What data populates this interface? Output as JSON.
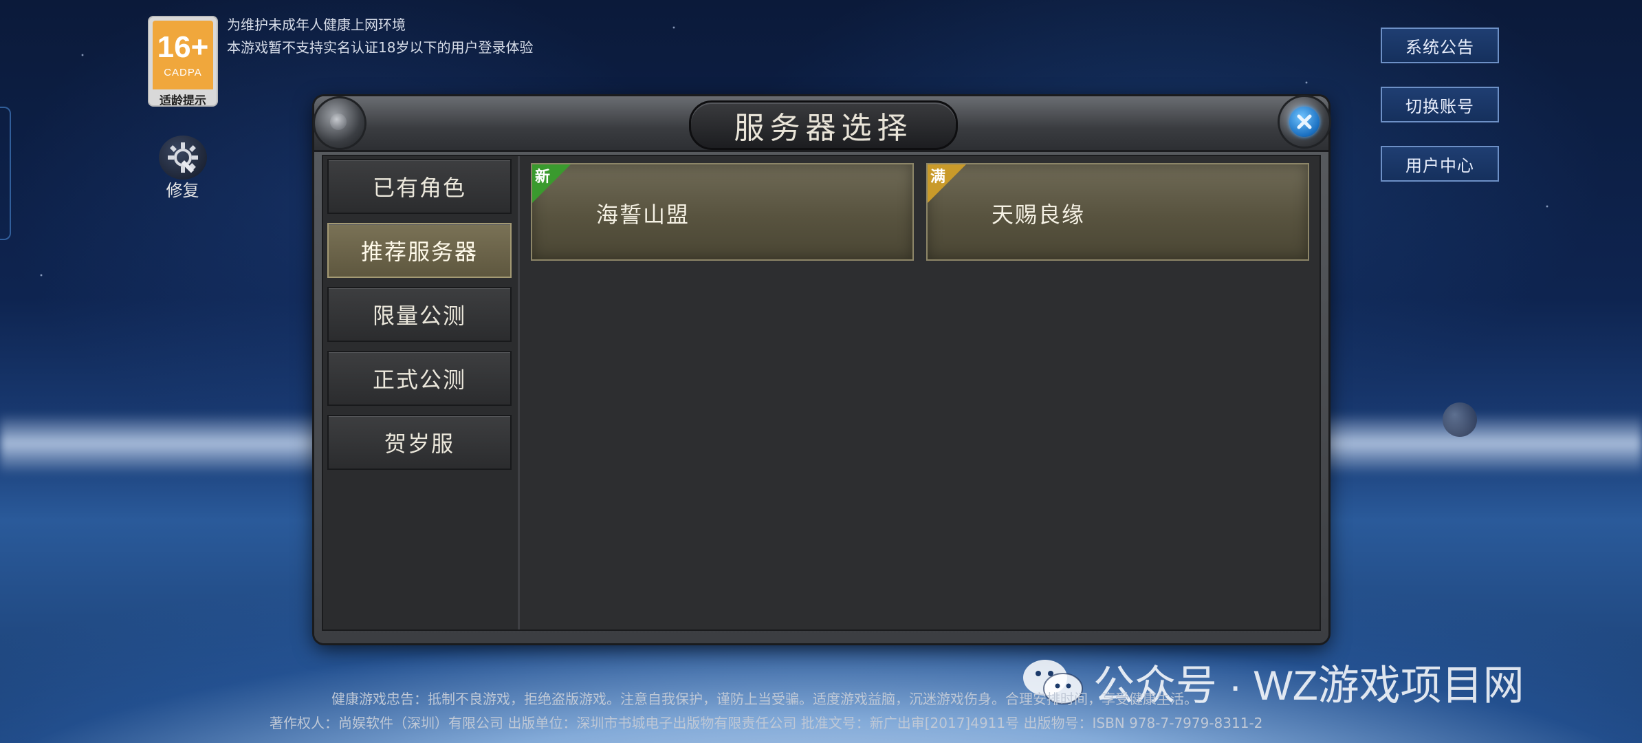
{
  "age_badge": {
    "rating": "16+",
    "org": "CADPA",
    "label": "适龄提示"
  },
  "notice": {
    "line1": "为维护未成年人健康上网环境",
    "line2": "本游戏暂不支持实名认证18岁以下的用户登录体验"
  },
  "repair": {
    "label": "修复",
    "icon": "repair-gear-icon"
  },
  "side_buttons": [
    "系统公告",
    "切换账号",
    "用户中心"
  ],
  "dialog": {
    "title": "服务器选择",
    "close_icon": "close-icon",
    "categories": [
      {
        "label": "已有角色",
        "active": false
      },
      {
        "label": "推荐服务器",
        "active": true
      },
      {
        "label": "限量公测",
        "active": false
      },
      {
        "label": "正式公测",
        "active": false
      },
      {
        "label": "贺岁服",
        "active": false
      }
    ],
    "servers": [
      {
        "name": "海誓山盟",
        "tag": "新",
        "tag_color": "#3a9a2e"
      },
      {
        "name": "天赐良缘",
        "tag": "满",
        "tag_color": "#c99a2a"
      }
    ]
  },
  "footer": {
    "line1": "健康游戏忠告：抵制不良游戏，拒绝盗版游戏。注意自我保护，谨防上当受骗。适度游戏益脑，沉迷游戏伤身。合理安排时间，享受健康生活。",
    "line2": "著作权人：尚娱软件（深圳）有限公司 出版单位：深圳市书城电子出版物有限责任公司 批准文号：新广出审[2017]4911号 出版物号：ISBN 978-7-7979-8311-2"
  },
  "watermark": {
    "text": "公众号 · WZ游戏项目网",
    "icon": "wechat-icon"
  }
}
